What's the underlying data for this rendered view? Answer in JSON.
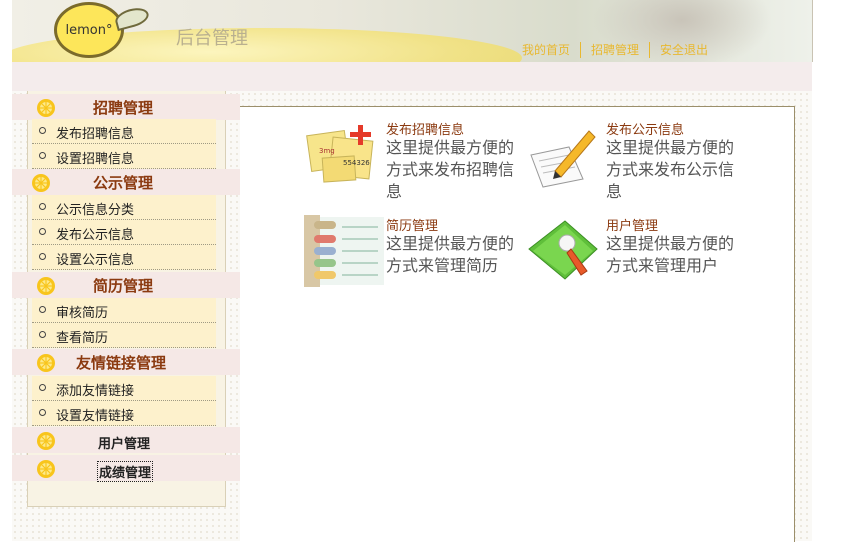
{
  "header": {
    "logo_text": "lemon°",
    "title": "后台管理",
    "nav": [
      "我的首页",
      "招聘管理",
      "安全退出"
    ]
  },
  "sidebar": {
    "sections": [
      {
        "title": "招聘管理",
        "items": [
          "发布招聘信息",
          "设置招聘信息"
        ]
      },
      {
        "title": "公示管理",
        "items": [
          "公示信息分类",
          "发布公示信息",
          "设置公示信息"
        ]
      },
      {
        "title": "简历管理",
        "items": [
          "审核简历",
          "查看简历"
        ]
      },
      {
        "title": "友情链接管理",
        "items": [
          "添加友情链接",
          "设置友情链接"
        ]
      },
      {
        "title": "用户管理",
        "items": []
      },
      {
        "title": "成绩管理",
        "items": []
      }
    ]
  },
  "main": {
    "cards": [
      {
        "title": "发布招聘信息",
        "desc": "这里提供最方便的方式来发布招聘信息",
        "icon": "notes-plus-icon"
      },
      {
        "title": "发布公示信息",
        "desc": "这里提供最方便的方式来发布公示信息",
        "icon": "pen-paper-icon"
      },
      {
        "title": "简历管理",
        "desc": "这里提供最方便的方式来管理简历",
        "icon": "tabs-folder-icon"
      },
      {
        "title": "用户管理",
        "desc": "这里提供最方便的方式来管理用户",
        "icon": "wrench-folder-icon"
      }
    ]
  },
  "colors": {
    "section_title": "#8b3a10",
    "menu_item_bg": "#fdf1cc",
    "nav_link": "#e8b830"
  }
}
